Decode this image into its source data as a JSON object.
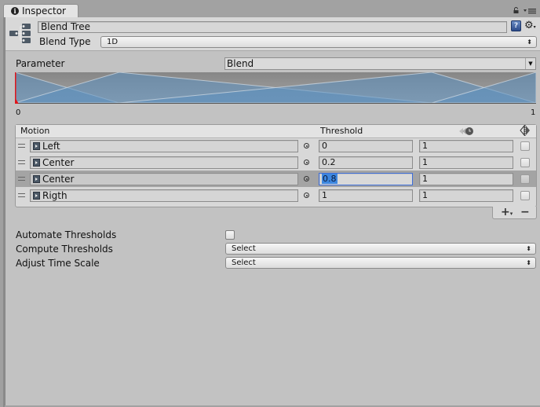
{
  "window": {
    "tab_label": "Inspector",
    "tab_icon": "info-icon",
    "lock_icon": "lock-icon",
    "menu_icon": "panel-menu-icon"
  },
  "header": {
    "icon": "blend-tree-icon",
    "name": "Blend Tree",
    "blend_type_label": "Blend Type",
    "blend_type_value": "1D",
    "help_icon": "help-icon",
    "settings_icon": "gear-icon"
  },
  "parameter": {
    "label": "Parameter",
    "value": "Blend",
    "current_value": 0,
    "range_min_label": "0",
    "range_max_label": "1"
  },
  "motion_list": {
    "columns": {
      "motion": "Motion",
      "threshold": "Threshold",
      "speed_icon": "time-scale-icon",
      "mirror_icon": "mirror-icon"
    },
    "rows": [
      {
        "motion": "Left",
        "threshold": "0",
        "speed": "1",
        "mirror": false,
        "selected": false
      },
      {
        "motion": "Center",
        "threshold": "0.2",
        "speed": "1",
        "mirror": false,
        "selected": false
      },
      {
        "motion": "Center",
        "threshold": "0.8",
        "speed": "1",
        "mirror": false,
        "selected": true
      },
      {
        "motion": "Rigth",
        "threshold": "1",
        "speed": "1",
        "mirror": false,
        "selected": false
      }
    ],
    "add_label": "+",
    "remove_label": "−"
  },
  "options": {
    "automate_thresholds_label": "Automate Thresholds",
    "automate_thresholds_checked": false,
    "compute_thresholds_label": "Compute Thresholds",
    "compute_thresholds_value": "Select",
    "adjust_time_scale_label": "Adjust Time Scale",
    "adjust_time_scale_value": "Select"
  },
  "graph": {
    "thresholds": [
      0,
      0.2,
      0.8,
      1
    ],
    "fill_color": "#5b8fc0",
    "background_color": "#8c8c8c",
    "marker_color": "#e0141a"
  }
}
